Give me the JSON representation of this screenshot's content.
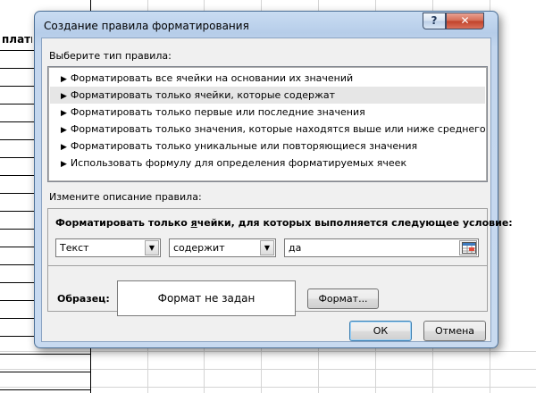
{
  "sheet": {
    "visible_header": "платы"
  },
  "dialog": {
    "title": "Создание правила форматирования",
    "help_label": "?",
    "close_label": "✕",
    "rule_type_label": "Выберите тип правила:",
    "rule_types": [
      "Форматировать все ячейки на основании их значений",
      "Форматировать только ячейки, которые содержат",
      "Форматировать только первые или последние значения",
      "Форматировать только значения, которые находятся выше или ниже среднего",
      "Форматировать только уникальные или повторяющиеся значения",
      "Использовать формулу для определения форматируемых ячеек"
    ],
    "selected_rule_index": 1,
    "description_label": "Измените описание правила:",
    "condition_title_pre": "Форматировать только ",
    "condition_title_accel": "я",
    "condition_title_post": "чейки, для которых выполняется следующее условие:",
    "combo1_value": "Текст",
    "combo2_value": "содержит",
    "text_value": "да",
    "sample_label": "Образец:",
    "preview_text": "Формат не задан",
    "format_button": "Формат...",
    "ok_button": "ОК",
    "cancel_button": "Отмена"
  },
  "colors": {
    "selection": "#e6e6e6",
    "dialog_frame": "#b6cde9",
    "close_button": "#c1412a"
  },
  "icons": {
    "list_arrow": "triangle-right-icon",
    "dropdown": "chevron-down-icon",
    "ref": "range-select-icon"
  }
}
